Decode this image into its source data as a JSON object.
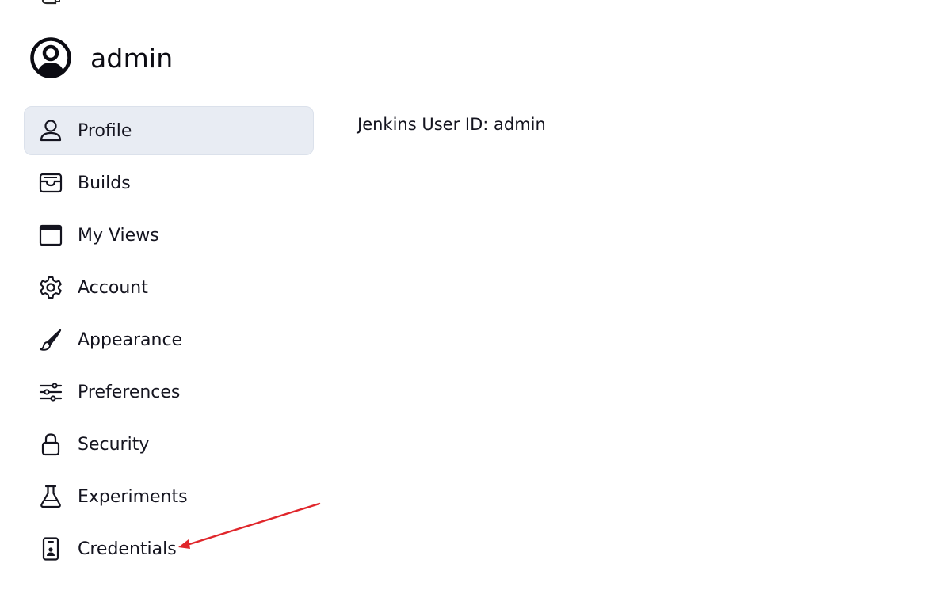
{
  "user": {
    "name": "admin",
    "icon": "user-circle-icon"
  },
  "side_panel": {
    "items": [
      {
        "label": "Profile",
        "icon": "person-icon",
        "active": true
      },
      {
        "label": "Builds",
        "icon": "inbox-tray-icon",
        "active": false
      },
      {
        "label": "My Views",
        "icon": "window-icon",
        "active": false
      },
      {
        "label": "Account",
        "icon": "gear-icon",
        "active": false
      },
      {
        "label": "Appearance",
        "icon": "paintbrush-icon",
        "active": false
      },
      {
        "label": "Preferences",
        "icon": "sliders-icon",
        "active": false
      },
      {
        "label": "Security",
        "icon": "lock-icon",
        "active": false
      },
      {
        "label": "Experiments",
        "icon": "flask-icon",
        "active": false
      },
      {
        "label": "Credentials",
        "icon": "id-badge-icon",
        "active": false
      }
    ]
  },
  "main": {
    "user_id_text": "Jenkins User ID: admin"
  },
  "colors": {
    "active_bg": "#e8ecf3",
    "text": "#14141f",
    "annotation_arrow": "#e0262b"
  }
}
